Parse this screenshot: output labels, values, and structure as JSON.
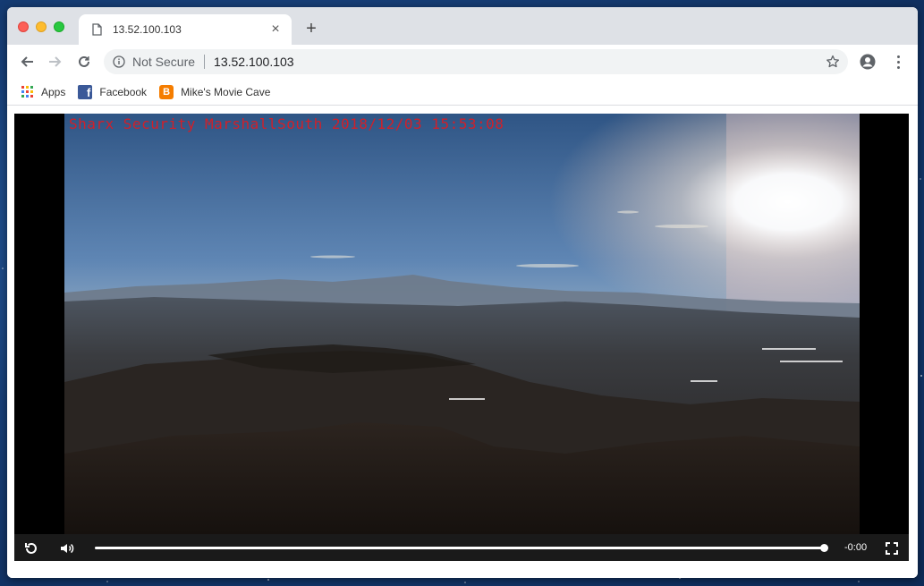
{
  "browser": {
    "tab": {
      "title": "13.52.100.103",
      "icon": "document-icon",
      "close": "×"
    },
    "new_tab": "+",
    "omnibox": {
      "security_label": "Not Secure",
      "url": "13.52.100.103"
    },
    "bookmarks": [
      {
        "label": "Apps",
        "icon": "apps-grid-icon"
      },
      {
        "label": "Facebook",
        "icon": "facebook-icon",
        "glyph": "f"
      },
      {
        "label": "Mike's Movie Cave",
        "icon": "blogger-icon",
        "glyph": "B"
      }
    ]
  },
  "video": {
    "overlay_text": "Sharx Security MarshallSouth 2018/12/03 15:53:08",
    "time_remaining": "-0:00",
    "progress": 1.0
  },
  "colors": {
    "overlay_text": "#d0202a",
    "tabstrip": "#dee1e6",
    "omnibox": "#f1f3f4",
    "controls_bar": "#1a1a1a",
    "desktop": "#173f78"
  }
}
